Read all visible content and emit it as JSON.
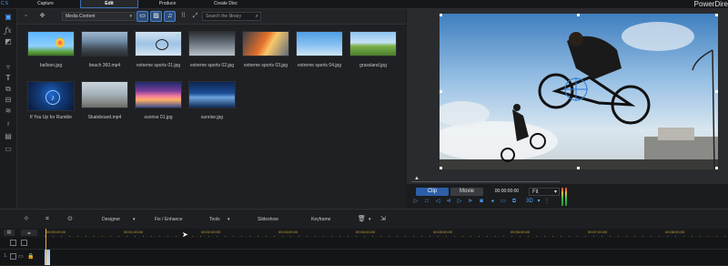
{
  "app": {
    "title": "PowerDire",
    "logo": "C S"
  },
  "tabs": [
    {
      "label": "Capture",
      "active": false
    },
    {
      "label": "Edit",
      "active": true
    },
    {
      "label": "Produce",
      "active": false
    },
    {
      "label": "Create Disc",
      "active": false
    }
  ],
  "rail": {
    "icons": [
      "media-room-icon",
      "fx-icon",
      "pip-icon",
      "particle-icon",
      "title-icon",
      "transition-icon",
      "audio-mix-icon",
      "voice-over-icon",
      "chapter-icon",
      "subtitle-icon"
    ]
  },
  "library": {
    "dropdown": "Media Content",
    "search_placeholder": "Search the library",
    "items": [
      {
        "name": "balloon.jpg",
        "checked": false
      },
      {
        "name": "beach 360.mp4",
        "checked": false
      },
      {
        "name": "extreme sports 01.jpg",
        "checked": true
      },
      {
        "name": "extreme sports 02.jpg",
        "checked": false
      },
      {
        "name": "extreme sports 03.jpg",
        "checked": false
      },
      {
        "name": "extreme sports 04.jpg",
        "checked": false
      },
      {
        "name": "grassland.jpg",
        "checked": false
      },
      {
        "name": "If You Up for Rumble",
        "checked": false
      },
      {
        "name": "Skateboard.mp4",
        "checked": false
      },
      {
        "name": "sunrise 01.jpg",
        "checked": false
      },
      {
        "name": "sunrise.jpg",
        "checked": false
      }
    ]
  },
  "playback": {
    "clip_label": "Clip",
    "movie_label": "Movie",
    "timecode": "00:00:00:00",
    "fit": "Fit",
    "threed": "3D"
  },
  "timeline_toolbar": {
    "designer": "Designer",
    "fix_enhance": "Fix / Enhance",
    "tools": "Tools",
    "slideshow": "Slideshow",
    "keyframe": "Keyframe"
  },
  "ruler": {
    "ticks": [
      "00:00:00:00",
      "00:01:00:00",
      "00:02:00:00",
      "00:03:00:00",
      "00:04:00:00",
      "00:05:00:00",
      "00:06:00:00",
      "00:07:00:00",
      "00:08:00:00"
    ]
  },
  "tracks": {
    "row1_label": "1."
  }
}
